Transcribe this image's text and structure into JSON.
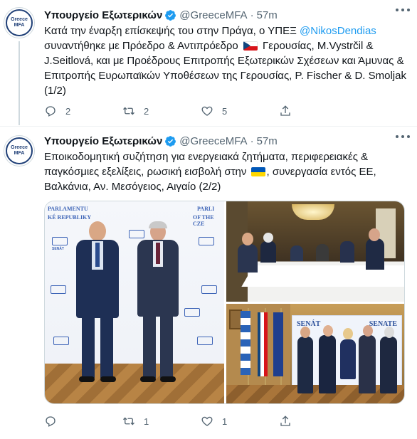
{
  "tweets": [
    {
      "account_name": "Υπουργείο Εξωτερικών",
      "handle": "@GreeceMFA",
      "separator": "·",
      "time": "57m",
      "avatar_line1": "Greece",
      "avatar_line2": "MFA",
      "text_part1": "Κατά την έναρξη επίσκεψής του στην Πράγα, ο ΥΠΕΞ ",
      "mention": "@NikosDendias",
      "text_part2": " συναντήθηκε με Πρόεδρο & Αντιπρόεδρο ",
      "text_part3": " Γερουσίας, M.Vystrčil & J.Seitlová, και με Προέδρους Επιτροπής Εξωτερικών Σχέσεων και Άμυνας & Επιτροπής  Ευρωπαϊκών Υποθέσεων της Γερουσίας, P. Fischer & D. Smoljak  (1/2)",
      "replies": "2",
      "retweets": "2",
      "likes": "5"
    },
    {
      "account_name": "Υπουργείο Εξωτερικών",
      "handle": "@GreeceMFA",
      "separator": "·",
      "time": "57m",
      "avatar_line1": "Greece",
      "avatar_line2": "MFA",
      "text_part1": "Εποικοδομητική συζήτηση για ενεργειακά ζητήματα, περιφερειακές & παγκόσμιες εξελίξεις, ρωσική εισβολή στην ",
      "text_part2": ", συνεργασία εντός ΕΕ, Βαλκάνια, Αν. Μεσόγειος, Αιγαίο (2/2)",
      "replies": "",
      "retweets": "1",
      "likes": "1"
    }
  ],
  "photo": {
    "backdrop_line1": "PARLAMENTU",
    "backdrop_line2": "KÉ REPUBLIKY",
    "backdrop_right1": "PARLI",
    "backdrop_right2": "OF THE CZE",
    "senat_label": "SENÁT",
    "banner_left": "SENÁT",
    "banner_right": "SENATE"
  },
  "colors": {
    "accent": "#1d9bf0",
    "secondary_text": "#536471",
    "divider": "#eff3f4"
  },
  "icons": [
    "verified-badge-icon",
    "more-icon",
    "reply-icon",
    "retweet-icon",
    "like-icon",
    "share-icon"
  ]
}
